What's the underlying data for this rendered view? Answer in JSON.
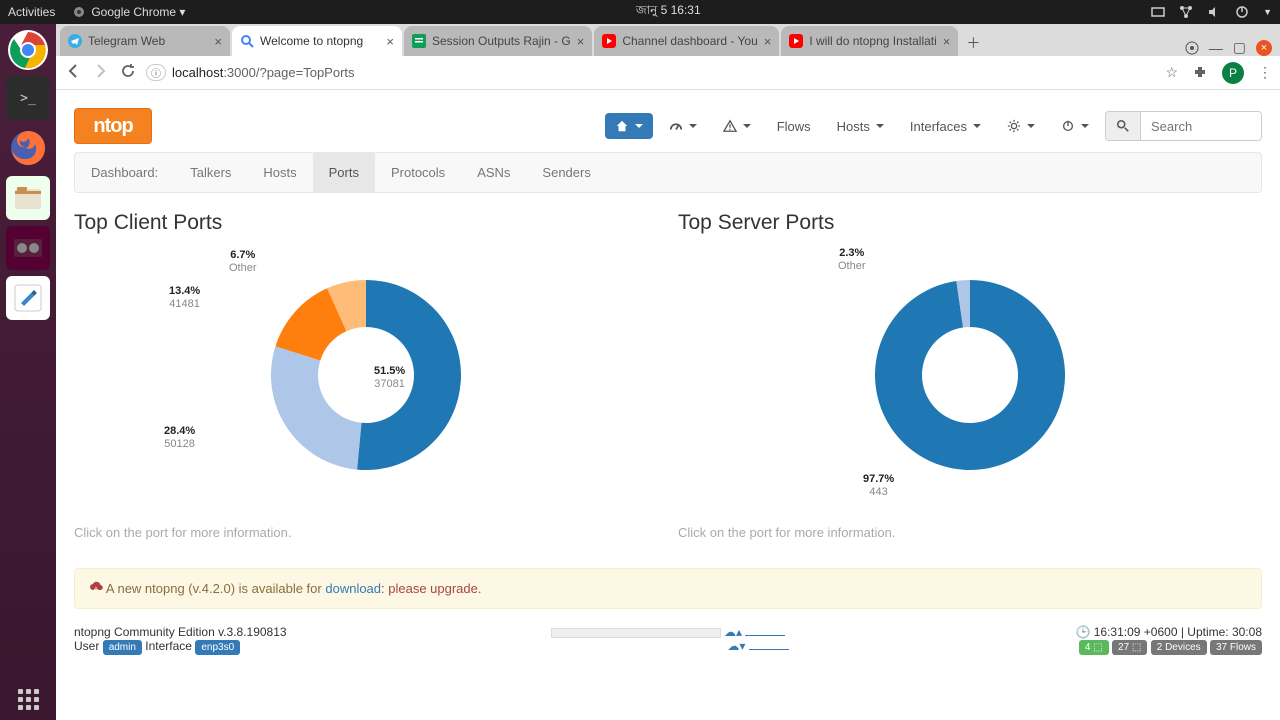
{
  "os": {
    "activities": "Activities",
    "appmenu": "Google Chrome ▾",
    "clock": "জানু 5  16:31"
  },
  "browser": {
    "tabs": [
      {
        "label": "Telegram Web",
        "fav": "tg"
      },
      {
        "label": "Welcome to ntopng",
        "fav": "mag",
        "active": true
      },
      {
        "label": "Session Outputs Rajin - G",
        "fav": "sheets"
      },
      {
        "label": "Channel dashboard - You",
        "fav": "yt"
      },
      {
        "label": "I will do ntopng Installati",
        "fav": "yt"
      }
    ],
    "url_proto": "ⓘ",
    "url_host": "localhost",
    "url_port": ":3000",
    "url_path": "/?page=TopPorts",
    "avatar": "P"
  },
  "nav": {
    "flows": "Flows",
    "hosts": "Hosts",
    "interfaces": "Interfaces",
    "search_placeholder": "Search"
  },
  "subnav": {
    "items": [
      "Dashboard:",
      "Talkers",
      "Hosts",
      "Ports",
      "Protocols",
      "ASNs",
      "Senders"
    ],
    "active": 3
  },
  "client_title": "Top Client Ports",
  "server_title": "Top Server Ports",
  "hint": "Click on the port for more information.",
  "alert": {
    "pre": "A new ntopng (v.4.2.0) is available for ",
    "link": "download",
    "post": ": please upgrade."
  },
  "footer": {
    "edition": "ntopng Community Edition v.3.8.190813",
    "user_label": "User",
    "user": "admin",
    "iface_label": "Interface",
    "iface": "enp3s0",
    "time": "16:31:09 +0600 | Uptime: 30:08",
    "b1": "4 ⬚",
    "b2": "27 ⬚",
    "b3": "2 Devices",
    "b4": "37 Flows"
  },
  "chart_data": [
    {
      "type": "pie",
      "title": "Top Client Ports",
      "series": [
        {
          "name": "37081",
          "value": 51.5,
          "color": "#1f77b4"
        },
        {
          "name": "50128",
          "value": 28.4,
          "color": "#aec7e8"
        },
        {
          "name": "41481",
          "value": 13.4,
          "color": "#ff7f0e"
        },
        {
          "name": "Other",
          "value": 6.7,
          "color": "#ffbb78"
        }
      ]
    },
    {
      "type": "pie",
      "title": "Top Server Ports",
      "series": [
        {
          "name": "443",
          "value": 97.7,
          "color": "#1f77b4"
        },
        {
          "name": "Other",
          "value": 2.3,
          "color": "#aec7e8"
        }
      ]
    }
  ]
}
